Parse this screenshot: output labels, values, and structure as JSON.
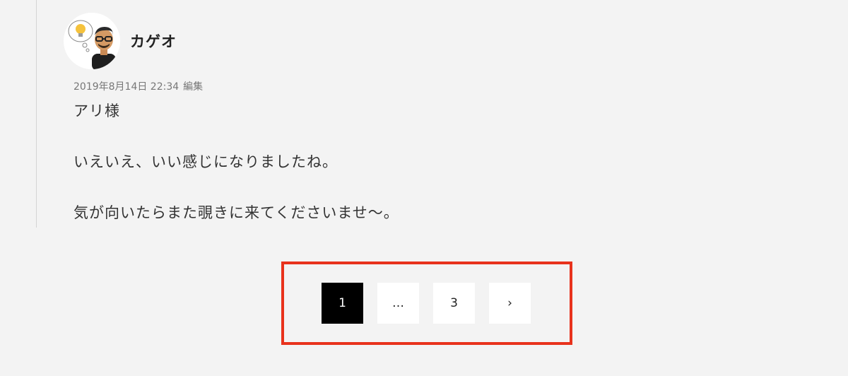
{
  "comment": {
    "author": "カゲオ",
    "date": "2019年8月14日 22:34",
    "edit_label": "編集",
    "paragraphs": [
      "アリ様",
      "いえいえ、いい感じになりましたね。",
      "気が向いたらまた覗きに来てくださいませ〜。"
    ]
  },
  "pagination": {
    "items": [
      {
        "label": "1",
        "current": true
      },
      {
        "label": "…",
        "current": false
      },
      {
        "label": "3",
        "current": false
      },
      {
        "label": "›",
        "current": false
      }
    ]
  },
  "colors": {
    "background": "#f3f3f3",
    "highlight": "#e8321c",
    "current_page": "#000000"
  }
}
